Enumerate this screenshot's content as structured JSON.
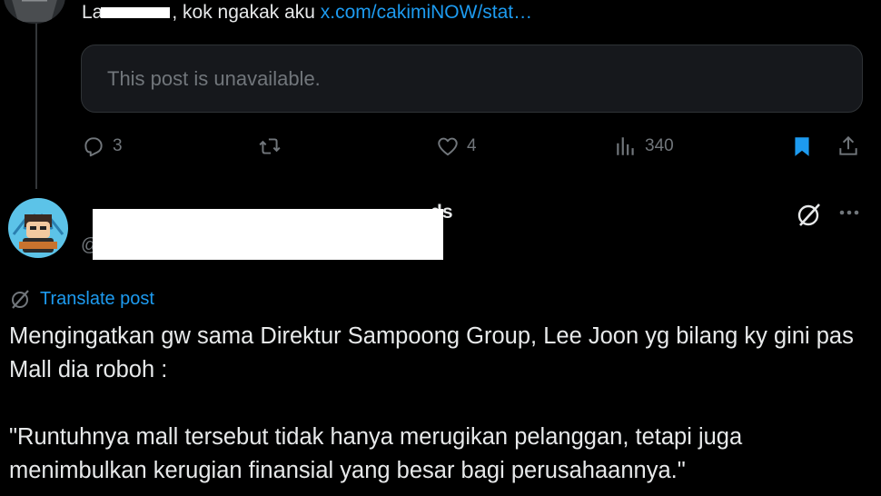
{
  "reply": {
    "text_prefix": "La",
    "text_middle": ", kok ngakak aku ",
    "link": "x.com/cakimiNOW/stat…",
    "unavailable_text": "This post is unavailable.",
    "actions": {
      "replies": "3",
      "likes": "4",
      "views": "340"
    }
  },
  "post": {
    "display_name_visible": "ds",
    "handle_prefix": "@",
    "translate_label": "Translate post",
    "paragraph1": "Mengingatkan gw sama Direktur Sampoong Group, Lee Joon yg bilang ky gini pas Mall dia roboh :",
    "paragraph2": "\"Runtuhnya mall tersebut tidak hanya merugikan pelanggan, tetapi juga menimbulkan kerugian finansial yang besar bagi perusahaannya.\""
  },
  "colors": {
    "background": "#000000",
    "text": "#e7e9ea",
    "muted": "#71767b",
    "accent": "#1d9bf0",
    "card": "#16181c"
  }
}
